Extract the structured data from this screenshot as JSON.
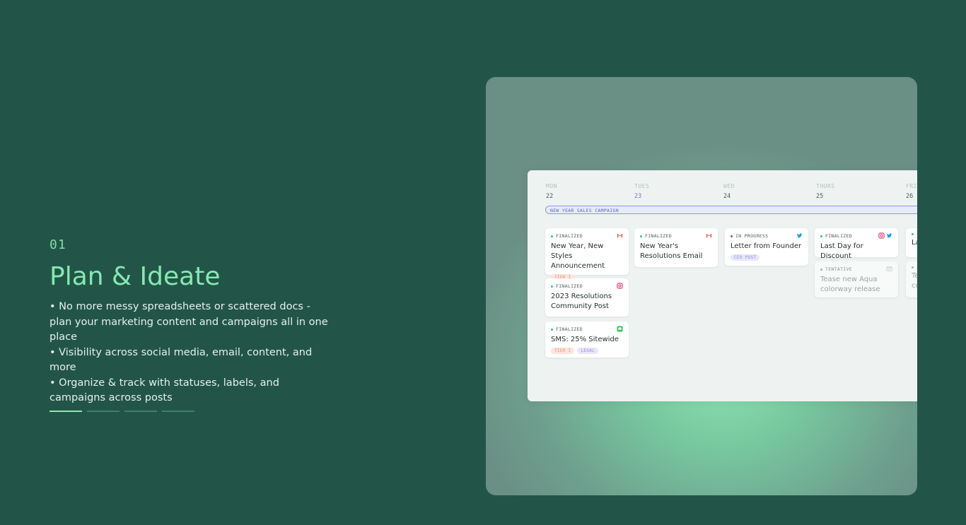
{
  "hero": {
    "step": "01",
    "title": "Plan & Ideate",
    "bullets": [
      "• No more messy spreadsheets or scattered docs - plan your marketing content and campaigns all in one place",
      "• Visibility across social media, email, content, and more",
      "• Organize & track with statuses, labels, and campaigns across posts"
    ]
  },
  "progress": {
    "steps": 4,
    "active": 1
  },
  "calendar": {
    "days": [
      {
        "name": "MON",
        "date": "22"
      },
      {
        "name": "TUES",
        "date": "23"
      },
      {
        "name": "WED",
        "date": "24"
      },
      {
        "name": "THURS",
        "date": "25"
      },
      {
        "name": "FRI",
        "date": "26"
      }
    ],
    "campaign": "NEW YEAR SALES CAMPAIGN",
    "cards": [
      {
        "status": "FINALIZED",
        "title": "New Year, New Styles Announcement",
        "chips": [
          "TIER I"
        ],
        "icons": [
          "gmail-icon"
        ]
      },
      {
        "status": "FINALIZED",
        "title": "2023 Resolutions Community Post",
        "chips": [],
        "icons": [
          "instagram-icon"
        ]
      },
      {
        "status": "FINALIZED",
        "title": "SMS: 25% Sitewide",
        "chips": [
          "TIER I",
          "LEGAL"
        ],
        "icons": [
          "sms-icon"
        ]
      },
      {
        "status": "FINALIZED",
        "title": "New Year's Resolutions Email",
        "chips": [],
        "icons": [
          "gmail-icon"
        ]
      },
      {
        "status": "IN PROGRESS",
        "title": "Letter from Founder",
        "chips": [
          "CEO POST"
        ],
        "icons": [
          "twitter-icon"
        ]
      },
      {
        "status": "FINALIZED",
        "title": "Last Day for Discount",
        "chips": [],
        "icons": [
          "instagram-icon",
          "twitter-icon"
        ]
      },
      {
        "status": "TENTATIVE",
        "title": "Tease new Aqua colorway release",
        "chips": [],
        "icons": [
          "email-outline-icon"
        ]
      },
      {
        "status": "",
        "title": "La",
        "chips": [],
        "icons": []
      },
      {
        "status": "",
        "title": "Te co",
        "chips": [],
        "icons": []
      }
    ]
  },
  "colors": {
    "background": "#225548",
    "accent": "#86e8b2",
    "finalized": "#3cbf7c",
    "in_progress": "#5560d8",
    "campaign": "#5a66c6"
  }
}
